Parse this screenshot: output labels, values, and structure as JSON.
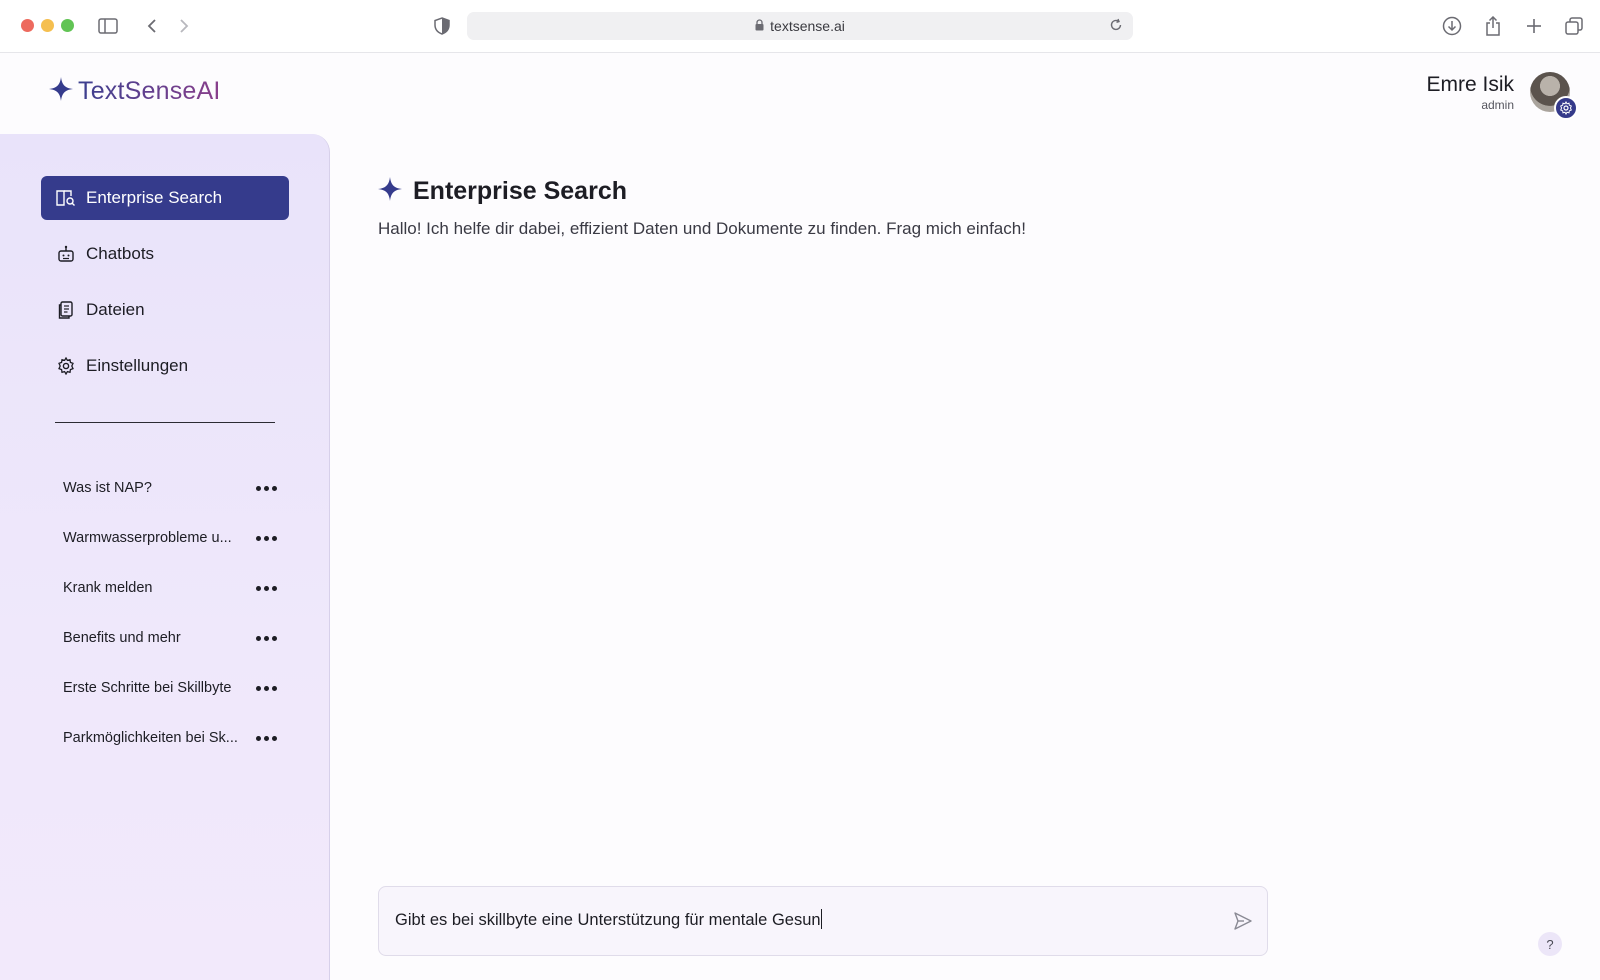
{
  "browser": {
    "url": "textsense.ai"
  },
  "app": {
    "logo_text": "TextSenseAI"
  },
  "user": {
    "name": "Emre Isik",
    "role": "admin"
  },
  "sidebar": {
    "nav": [
      {
        "label": "Enterprise Search",
        "icon": "book-search-icon",
        "active": true
      },
      {
        "label": "Chatbots",
        "icon": "robot-icon",
        "active": false
      },
      {
        "label": "Dateien",
        "icon": "document-icon",
        "active": false
      },
      {
        "label": "Einstellungen",
        "icon": "gear-icon",
        "active": false
      }
    ],
    "history": [
      {
        "label": "Was ist NAP?"
      },
      {
        "label": "Warmwasserprobleme u..."
      },
      {
        "label": "Krank melden"
      },
      {
        "label": "Benefits und mehr"
      },
      {
        "label": "Erste Schritte bei Skillbyte"
      },
      {
        "label": "Parkmöglichkeiten bei Sk..."
      }
    ]
  },
  "main": {
    "title": "Enterprise Search",
    "subtitle": "Hallo! Ich helfe dir dabei, effizient Daten und Dokumente zu finden. Frag mich einfach!",
    "input_value": "Gibt es bei skillbyte eine Unterstützung für mentale Gesun"
  },
  "help": {
    "label": "?"
  },
  "colors": {
    "accent": "#353b8c",
    "sidebar_bg": "#ece5fa"
  }
}
